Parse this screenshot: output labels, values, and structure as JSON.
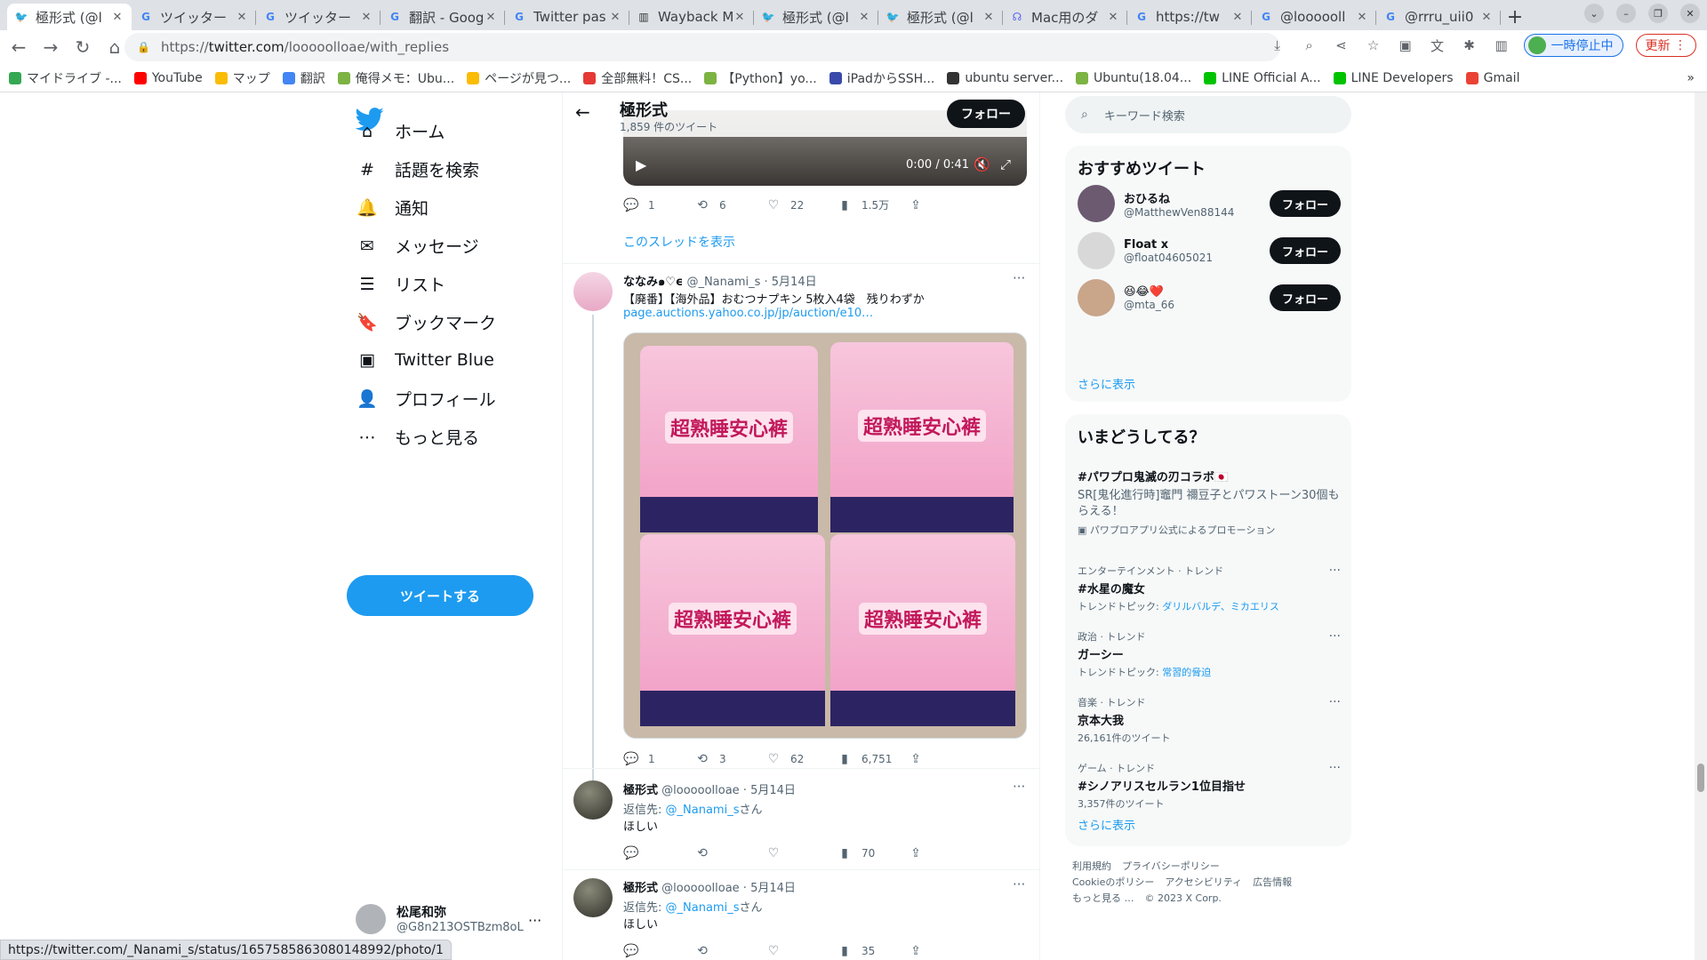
{
  "browser": {
    "tabs": [
      {
        "title": "極形式 (@l",
        "favicon": "twitter-icon",
        "active": true
      },
      {
        "title": "ツイッター",
        "favicon": "google-icon"
      },
      {
        "title": "ツイッター",
        "favicon": "google-icon"
      },
      {
        "title": "翻訳 - Goog",
        "favicon": "google-icon"
      },
      {
        "title": "Twitter pas",
        "favicon": "google-icon"
      },
      {
        "title": "Wayback M",
        "favicon": "wayback-icon"
      },
      {
        "title": "極形式 (@l",
        "favicon": "twitter-icon"
      },
      {
        "title": "極形式 (@l",
        "favicon": "twitter-icon"
      },
      {
        "title": "Mac用のダ",
        "favicon": "github-icon"
      },
      {
        "title": "https://tw",
        "favicon": "google-icon"
      },
      {
        "title": "@loooooll",
        "favicon": "google-icon"
      },
      {
        "title": "@rrru_uii0",
        "favicon": "google-icon"
      }
    ],
    "url_scheme": "https://",
    "url_host": "twitter.com",
    "url_path": "/looooolloae/with_replies",
    "pause_label": "一時停止中",
    "update_label": "更新",
    "bookmarks": [
      {
        "label": "マイドライブ -...",
        "color": "#34a853"
      },
      {
        "label": "YouTube",
        "color": "#ff0000"
      },
      {
        "label": "マップ",
        "color": "#fbbc04"
      },
      {
        "label": "翻訳",
        "color": "#4285f4"
      },
      {
        "label": "俺得メモ：Ubu...",
        "color": "#7cb342"
      },
      {
        "label": "ページが見つ...",
        "color": "#fbbc04"
      },
      {
        "label": "全部無料！CS...",
        "color": "#e53935"
      },
      {
        "label": "【Python】yo...",
        "color": "#7cb342"
      },
      {
        "label": "iPadからSSH...",
        "color": "#3949ab"
      },
      {
        "label": "ubuntu server...",
        "color": "#333333"
      },
      {
        "label": "Ubuntu(18.04...",
        "color": "#7cb342"
      },
      {
        "label": "LINE Official A...",
        "color": "#00c300"
      },
      {
        "label": "LINE Developers",
        "color": "#00c300"
      },
      {
        "label": "Gmail",
        "color": "#ea4335"
      }
    ],
    "status_url": "https://twitter.com/_Nanami_s/status/1657585863080148992/photo/1"
  },
  "nav": {
    "items": [
      {
        "label": "ホーム",
        "icon": "home-icon"
      },
      {
        "label": "話題を検索",
        "icon": "hashtag-icon"
      },
      {
        "label": "通知",
        "icon": "bell-icon"
      },
      {
        "label": "メッセージ",
        "icon": "mail-icon"
      },
      {
        "label": "リスト",
        "icon": "list-icon"
      },
      {
        "label": "ブックマーク",
        "icon": "bookmark-icon"
      },
      {
        "label": "Twitter Blue",
        "icon": "twitter-blue-icon"
      },
      {
        "label": "プロフィール",
        "icon": "profile-icon"
      },
      {
        "label": "もっと見る",
        "icon": "more-icon"
      }
    ],
    "tweet_button": "ツイートする",
    "account_name": "松尾和弥",
    "account_handle": "@G8n213OSTBzm8oL"
  },
  "profile_header": {
    "name": "極形式",
    "count": "1,859 件のツイート",
    "follow": "フォロー"
  },
  "video": {
    "time": "0:00 / 0:41"
  },
  "tweet0": {
    "replies": "1",
    "retweets": "6",
    "likes": "22",
    "views": "1.5万",
    "show_thread": "このスレッドを表示"
  },
  "tweet1": {
    "name": "ななみ๑♡ϵ",
    "meta": "@_Nanami_s · 5月14日",
    "text": "【廃番】【海外品】おむつナプキン 5枚入4袋　残りわずか",
    "link": "page.auctions.yahoo.co.jp/jp/auction/e10…",
    "pkg_logo": "超熟睡安心裤",
    "replies": "1",
    "retweets": "3",
    "likes": "62",
    "views": "6,751"
  },
  "tweet2": {
    "name": "極形式",
    "meta": "@looooolloae · 5月14日",
    "reply_prefix": "返信先: ",
    "reply_to": "@_Nanami_s",
    "reply_suffix": "さん",
    "text": "ほしい",
    "views": "70"
  },
  "tweet3": {
    "name": "極形式",
    "meta": "@looooolloae · 5月14日",
    "reply_prefix": "返信先: ",
    "reply_to": "@_Nanami_s",
    "reply_suffix": "さん",
    "text": "ほしい",
    "views": "35"
  },
  "sidebar": {
    "search_placeholder": "キーワード検索",
    "wtf_title": "おすすめツイート",
    "wtf": [
      {
        "name": "おひるね",
        "handle": "@MatthewVen88144",
        "follow": "フォロー",
        "color": "#6b5a70"
      },
      {
        "name": "Float x",
        "handle": "@float04605021",
        "follow": "フォロー",
        "color": "#d8d8d8"
      },
      {
        "name": "😆😂❤️",
        "handle": "@mta_66",
        "follow": "フォロー",
        "color": "#c9a58a"
      }
    ],
    "show_more": "さらに表示",
    "trends_title": "いまどうしてる？",
    "promo": {
      "name": "#パワプロ鬼滅の刃コラボ🇯🇵",
      "desc": "SR[鬼化進行時]竈門 禰豆子とパワストーン30個もらえる！",
      "by": "パワプロアプリ公式によるプロモーション"
    },
    "trends": [
      {
        "cat": "エンターテインメント · トレンド",
        "name": "#水星の魔女",
        "sub_prefix": "トレンドトピック: ",
        "sub_links": "ダリルバルデ、ミカエリス"
      },
      {
        "cat": "政治 · トレンド",
        "name": "ガーシー",
        "sub_prefix": "トレンドトピック: ",
        "sub_links": "常習的脅迫"
      },
      {
        "cat": "音楽 · トレンド",
        "name": "京本大我",
        "sub_prefix": "26,161件のツイート",
        "sub_links": ""
      },
      {
        "cat": "ゲーム · トレンド",
        "name": "#シノアリスセルラン1位目指せ",
        "sub_prefix": "3,357件のツイート",
        "sub_links": ""
      }
    ],
    "show_more2": "さらに表示",
    "footer": [
      "利用規約",
      "プライバシーポリシー",
      "Cookieのポリシー",
      "アクセシビリティ",
      "広告情報",
      "もっと見る …",
      "© 2023 X Corp."
    ]
  }
}
